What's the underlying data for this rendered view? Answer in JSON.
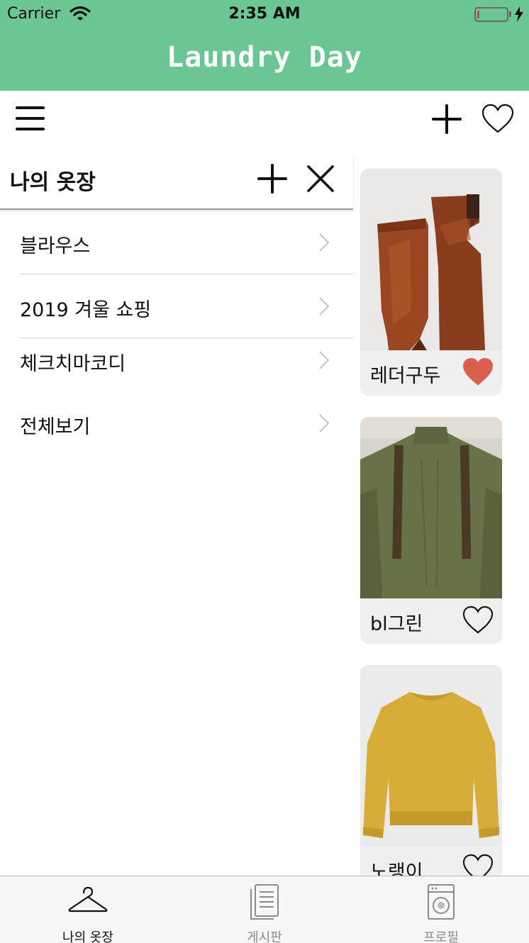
{
  "status_bar": {
    "carrier": "Carrier",
    "time": "2:35 AM",
    "wifi_icon": "wifi-icon",
    "battery_icon": "battery-low-icon"
  },
  "app": {
    "title": "Laundry Day",
    "accent_color": "#6cc595"
  },
  "toolbar": {
    "menu_icon": "hamburger-menu-icon",
    "add_icon": "plus-icon",
    "favorites_icon": "heart-outline-icon"
  },
  "closet_panel": {
    "title": "나의 옷장",
    "add_icon": "plus-icon",
    "close_icon": "close-x-icon",
    "folders": [
      {
        "label": "블라우스"
      },
      {
        "label": "2019 겨울 쇼핑"
      },
      {
        "label": "체크치마코디"
      },
      {
        "label": "전체보기"
      }
    ]
  },
  "clothing_items": [
    {
      "name": "레더구두",
      "favorited": true,
      "image": "brown-leather-boots"
    },
    {
      "name": "bl그린",
      "favorited": false,
      "image": "olive-green-blouse"
    },
    {
      "name": "노랭이",
      "favorited": false,
      "image": "yellow-knit-sweater"
    }
  ],
  "favorite_color": "#d9604f",
  "tab_bar": {
    "tabs": [
      {
        "label": "나의 옷장",
        "icon": "hanger-icon",
        "active": true
      },
      {
        "label": "게시판",
        "icon": "document-list-icon",
        "active": false
      },
      {
        "label": "프로필",
        "icon": "washing-machine-icon",
        "active": false
      }
    ]
  }
}
